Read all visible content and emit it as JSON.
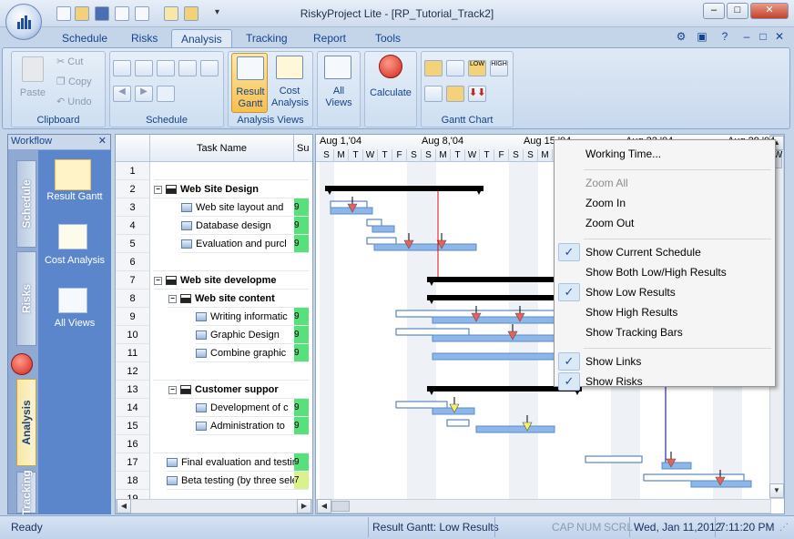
{
  "window": {
    "title": "RiskyProject Lite - [RP_Tutorial_Track2]",
    "minimize": "–",
    "maximize": "□",
    "close": "✕"
  },
  "ribbon": {
    "tabs": [
      {
        "label": "Schedule"
      },
      {
        "label": "Risks"
      },
      {
        "label": "Analysis",
        "active": true
      },
      {
        "label": "Tracking"
      },
      {
        "label": "Report"
      },
      {
        "label": "Tools"
      }
    ],
    "clipboard": {
      "paste": "Paste",
      "cut": "Cut",
      "copy": "Copy",
      "undo": "Undo",
      "label": "Clipboard"
    },
    "schedule": {
      "label": "Schedule"
    },
    "analysis_views": {
      "result_gantt": "Result Gantt",
      "cost_analysis": "Cost Analysis",
      "label": "Analysis Views"
    },
    "all_views": "All Views",
    "calculate": "Calculate",
    "gantt_chart": {
      "label": "Gantt Chart",
      "low": "LOW",
      "high": "HIGH"
    }
  },
  "workflow": {
    "title": "Workflow",
    "items": [
      {
        "label": "Result Gantt"
      },
      {
        "label": "Cost Analysis"
      },
      {
        "label": "All Views"
      }
    ],
    "tabs": [
      {
        "label": "Schedule"
      },
      {
        "label": "Risks"
      },
      {
        "label": "Analysis",
        "active": true
      },
      {
        "label": "Tracking"
      }
    ]
  },
  "grid": {
    "col_task": "Task Name",
    "col_suc": "Su",
    "rows": [
      {
        "n": "1",
        "name": "",
        "level": 0,
        "type": "empty",
        "suc": ""
      },
      {
        "n": "2",
        "name": "Web Site Design",
        "level": 0,
        "type": "summary",
        "suc": ""
      },
      {
        "n": "3",
        "name": "Web site layout and",
        "level": 1,
        "type": "task",
        "suc": "9"
      },
      {
        "n": "4",
        "name": "Database design",
        "level": 1,
        "type": "task",
        "suc": "9"
      },
      {
        "n": "5",
        "name": "Evaluation and purcl",
        "level": 1,
        "type": "task",
        "suc": "9"
      },
      {
        "n": "6",
        "name": "",
        "level": 0,
        "type": "empty",
        "suc": ""
      },
      {
        "n": "7",
        "name": "Web site developme",
        "level": 0,
        "type": "summary",
        "suc": ""
      },
      {
        "n": "8",
        "name": "Web site content",
        "level": 1,
        "type": "summary",
        "suc": ""
      },
      {
        "n": "9",
        "name": "Writing informatic",
        "level": 2,
        "type": "task",
        "suc": "9"
      },
      {
        "n": "10",
        "name": "Graphic Design",
        "level": 2,
        "type": "task",
        "suc": "9"
      },
      {
        "n": "11",
        "name": "Combine graphic",
        "level": 2,
        "type": "task",
        "suc": "9"
      },
      {
        "n": "12",
        "name": "",
        "level": 0,
        "type": "empty",
        "suc": ""
      },
      {
        "n": "13",
        "name": "Customer suppor",
        "level": 1,
        "type": "summary",
        "suc": ""
      },
      {
        "n": "14",
        "name": "Development of c",
        "level": 2,
        "type": "task",
        "suc": "9"
      },
      {
        "n": "15",
        "name": "Administration to",
        "level": 2,
        "type": "task",
        "suc": "9"
      },
      {
        "n": "16",
        "name": "",
        "level": 0,
        "type": "empty",
        "suc": ""
      },
      {
        "n": "17",
        "name": "Final evaluation and testing",
        "level": 0,
        "type": "task",
        "suc": "9"
      },
      {
        "n": "18",
        "name": "Beta testing (by three sele",
        "level": 0,
        "type": "task",
        "suc": "7"
      },
      {
        "n": "19",
        "name": "",
        "level": 0,
        "type": "empty",
        "suc": ""
      }
    ]
  },
  "gantt": {
    "weeks": [
      "Aug 1,'04",
      "Aug 8,'04",
      "Aug 15,'04",
      "Aug 22,'04",
      "Aug 29,'04"
    ],
    "days": [
      "S",
      "M",
      "T",
      "W",
      "T",
      "F",
      "S",
      "S",
      "M",
      "T",
      "W",
      "T",
      "F",
      "S",
      "S",
      "M",
      "T",
      "W",
      "T",
      "F",
      "S",
      "S",
      "M",
      "T",
      "W",
      "T",
      "F",
      "S",
      "S",
      "M",
      "T",
      "W"
    ]
  },
  "context_menu": {
    "items": [
      {
        "label": "Working Time...",
        "checked": false,
        "disabled": false
      },
      {
        "sep": true
      },
      {
        "label": "Zoom All",
        "checked": false,
        "disabled": true
      },
      {
        "label": "Zoom In",
        "checked": false,
        "disabled": false
      },
      {
        "label": "Zoom Out",
        "checked": false,
        "disabled": false
      },
      {
        "sep": true
      },
      {
        "label": "Show Current Schedule",
        "checked": true,
        "disabled": false
      },
      {
        "label": "Show Both Low/High Results",
        "checked": false,
        "disabled": false
      },
      {
        "label": "Show Low Results",
        "checked": true,
        "disabled": false
      },
      {
        "label": "Show High Results",
        "checked": false,
        "disabled": false
      },
      {
        "label": "Show Tracking Bars",
        "checked": false,
        "disabled": false
      },
      {
        "sep": true
      },
      {
        "label": "Show Links",
        "checked": true,
        "disabled": false
      },
      {
        "label": "Show Risks",
        "checked": true,
        "disabled": false
      }
    ]
  },
  "status": {
    "ready": "Ready",
    "view": "Result Gantt: Low Results",
    "cap": "CAP",
    "num": "NUM",
    "scrl": "SCRL",
    "date": "Wed, Jan 11,2012",
    "time": "7:11:20 PM"
  },
  "colors": {
    "accent": "#15428b",
    "bar_blue": "#8db7e8",
    "risk_red": "#e8605c",
    "risk_yellow": "#f5ee6a",
    "green_cell": "#58e07a"
  }
}
